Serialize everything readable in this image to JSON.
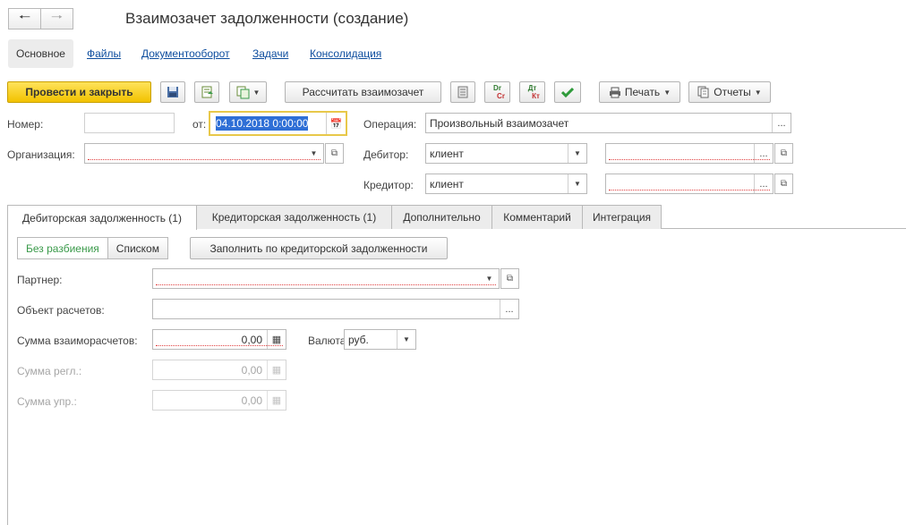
{
  "window": {
    "title": "Взаимозачет задолженности (создание)"
  },
  "nav_tabs": [
    "Основное",
    "Файлы",
    "Документооборот",
    "Задачи",
    "Консолидация"
  ],
  "toolbar": {
    "post_close_label": "Провести и закрыть",
    "calc_label": "Рассчитать взаимозачет",
    "dr_top": "Dr",
    "dr_bottom": "Cr",
    "dt_top": "Дт",
    "dt_bottom": "Кт",
    "print_label": "Печать",
    "reports_label": "Отчеты"
  },
  "header_form": {
    "number_label": "Номер:",
    "number_value": "",
    "date_label": "от:",
    "date_value": "04.10.2018  0:00:00",
    "operation_label": "Операция:",
    "operation_value": "Произвольный взаимозачет",
    "organization_label": "Организация:",
    "organization_value": "",
    "debtor_label": "Дебитор:",
    "debtor_type": "клиент",
    "debtor_value": "",
    "creditor_label": "Кредитор:",
    "creditor_type": "клиент",
    "creditor_value": ""
  },
  "content_tabs": [
    "Дебиторская задолженность (1)",
    "Кредиторская задолженность (1)",
    "Дополнительно",
    "Комментарий",
    "Интеграция"
  ],
  "debt_tab": {
    "mode_no_split": "Без разбиения",
    "mode_list": "Списком",
    "fill_button": "Заполнить по кредиторской задолженности",
    "partner_label": "Партнер:",
    "partner_value": "",
    "settlement_object_label": "Объект расчетов:",
    "settlement_object_value": "",
    "amount_label": "Сумма взаиморасчетов:",
    "amount_value": "0,00",
    "currency_label": "Валюта:",
    "currency_value": "руб.",
    "amount_reg_label": "Сумма регл.:",
    "amount_reg_value": "0,00",
    "amount_mgmt_label": "Сумма упр.:",
    "amount_mgmt_value": "0,00"
  },
  "colors": {
    "primary_button": "#f2c200",
    "link": "#0d4d9e",
    "active_mode": "#3a9a4a",
    "required_underline": "#e04040"
  }
}
